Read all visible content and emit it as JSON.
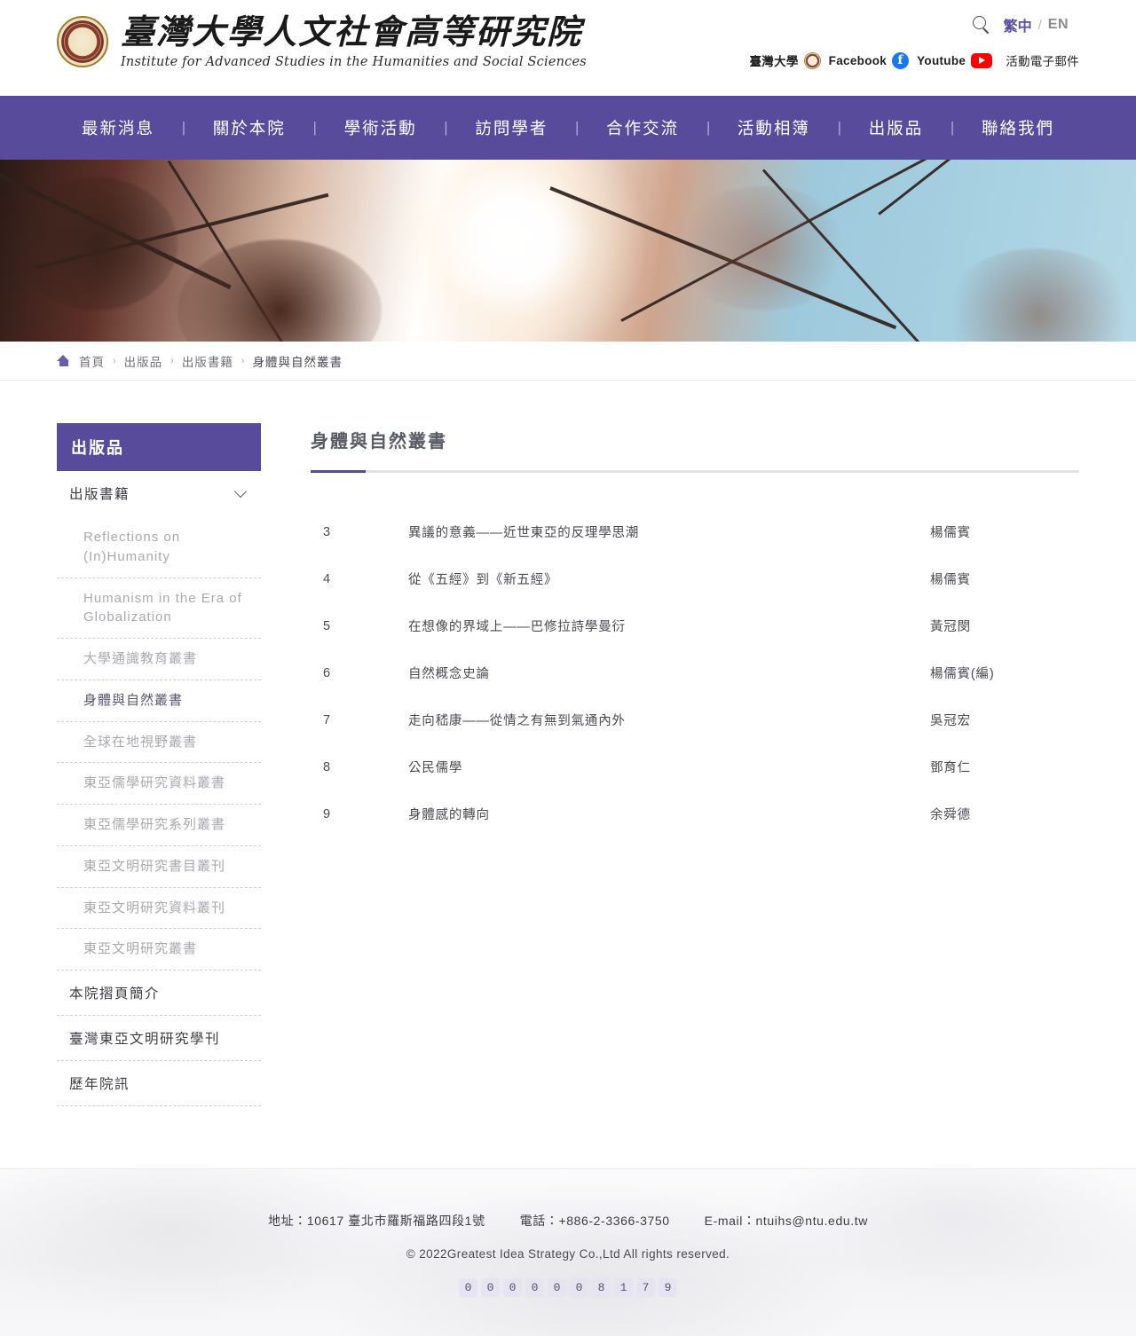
{
  "header": {
    "logo_cn": "臺灣大學人文社會高等研究院",
    "logo_en": "Institute for Advanced Studies in the Humanities and Social Sciences",
    "search_icon": "search-icon",
    "lang_cn": "繁中",
    "lang_sep": "/",
    "lang_en": "EN",
    "social": [
      {
        "label": "臺灣大學",
        "icon": "ntu-seal-icon"
      },
      {
        "label": "Facebook",
        "icon": "facebook-icon"
      },
      {
        "label": "Youtube",
        "icon": "youtube-icon"
      },
      {
        "label": "活動電子郵件",
        "icon": ""
      }
    ]
  },
  "nav": {
    "items": [
      "最新消息",
      "關於本院",
      "學術活動",
      "訪問學者",
      "合作交流",
      "活動相簿",
      "出版品",
      "聯絡我們"
    ],
    "divider": "|",
    "bg_color": "#594b9c"
  },
  "breadcrumb": {
    "home_icon": "home-icon",
    "items": [
      "首頁",
      "出版品",
      "出版書籍"
    ],
    "separator": "›",
    "current": "身體與自然叢書"
  },
  "sidebar": {
    "heading": "出版品",
    "group_title": "出版書籍",
    "chevron_icon": "chevron-down-icon",
    "sub_items": [
      "Reflections on (In)Humanity",
      "Humanism in the Era of Globalization",
      "大學通識教育叢書",
      "身體與自然叢書",
      "全球在地視野叢書",
      "東亞儒學研究資料叢書",
      "東亞儒學研究系列叢書",
      "東亞文明研究書目叢刊",
      "東亞文明研究資料叢刊",
      "東亞文明研究叢書"
    ],
    "active_sub_index": 3,
    "top_items": [
      "本院摺頁簡介",
      "臺灣東亞文明研究學刊",
      "歷年院訊"
    ]
  },
  "main": {
    "title": "身體與自然叢書",
    "accent_color": "#594b9c",
    "books": [
      {
        "no": "3",
        "title": "異議的意義——近世東亞的反理學思潮",
        "author": "楊儒賓"
      },
      {
        "no": "4",
        "title": "從《五經》到《新五經》",
        "author": "楊儒賓"
      },
      {
        "no": "5",
        "title": "在想像的界域上——巴修拉詩學曼衍",
        "author": "黃冠閔"
      },
      {
        "no": "6",
        "title": "自然概念史論",
        "author": "楊儒賓(編)"
      },
      {
        "no": "7",
        "title": "走向嵇康——從情之有無到氣通內外",
        "author": "吳冠宏"
      },
      {
        "no": "8",
        "title": "公民儒學",
        "author": "鄧育仁"
      },
      {
        "no": "9",
        "title": "身體感的轉向",
        "author": "余舜德"
      }
    ]
  },
  "footer": {
    "address": "地址：10617 臺北市羅斯福路四段1號",
    "phone": "電話：+886-2-3366-3750",
    "email": "E-mail：ntuihs@ntu.edu.tw",
    "copyright": "© 2022Greatest Idea Strategy Co.,Ltd All rights reserved.",
    "counter": [
      "0",
      "0",
      "0",
      "0",
      "0",
      "0",
      "8",
      "1",
      "7",
      "9"
    ]
  }
}
